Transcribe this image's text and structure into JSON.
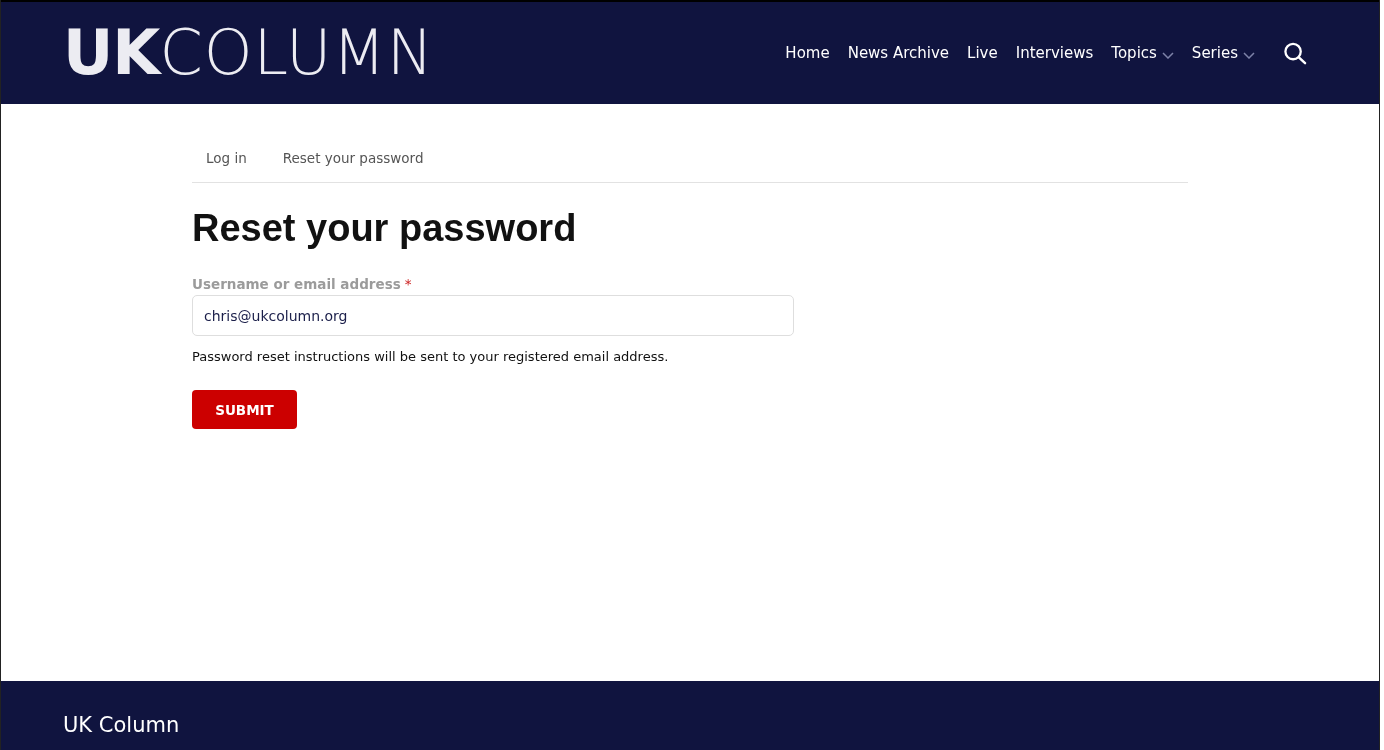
{
  "header": {
    "logo": "**UK**COLUMN",
    "nav": [
      {
        "label": "Home",
        "dropdown": false
      },
      {
        "label": "News Archive",
        "dropdown": false
      },
      {
        "label": "Live",
        "dropdown": false
      },
      {
        "label": "Interviews",
        "dropdown": false
      },
      {
        "label": "Topics",
        "dropdown": true
      },
      {
        "label": "Series",
        "dropdown": true
      }
    ]
  },
  "tabs": [
    {
      "label": "Log in"
    },
    {
      "label": "Reset your password"
    }
  ],
  "heading": "Reset your password",
  "form": {
    "field": {
      "label": "Username or email address",
      "required_mark": "*",
      "value": "chris@ukcolumn.org"
    },
    "description": "Password reset instructions will be sent to your registered email address.",
    "submit": "SUBMIT"
  },
  "footer": {
    "title": "UK Column"
  }
}
